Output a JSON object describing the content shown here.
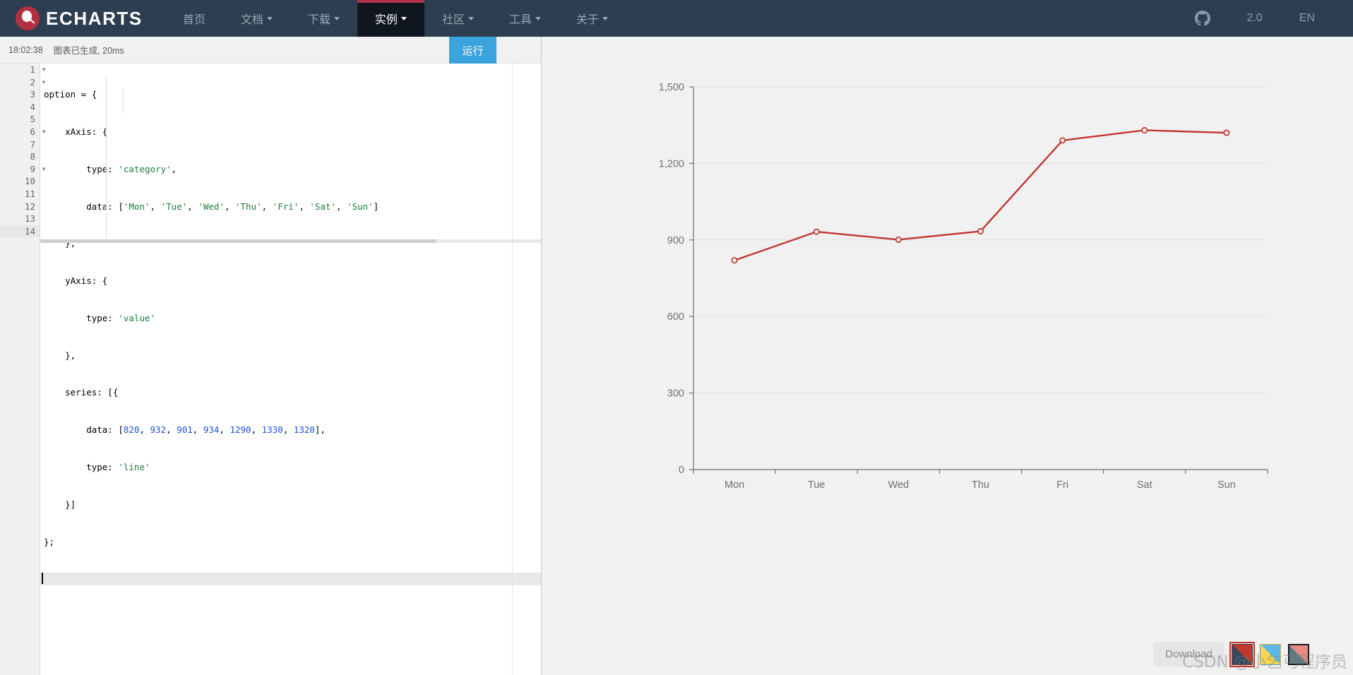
{
  "navbar": {
    "brand": "ECHARTS",
    "brand_icon": "echarts-logo-icon",
    "items": [
      {
        "label": "首页",
        "caret": false,
        "active": false
      },
      {
        "label": "文档",
        "caret": true,
        "active": false
      },
      {
        "label": "下载",
        "caret": true,
        "active": false
      },
      {
        "label": "实例",
        "caret": true,
        "active": true
      },
      {
        "label": "社区",
        "caret": true,
        "active": false
      },
      {
        "label": "工具",
        "caret": true,
        "active": false
      },
      {
        "label": "关于",
        "caret": true,
        "active": false
      }
    ],
    "github_icon": "github-icon",
    "version": "2.0",
    "language": "EN",
    "bg_color": "#2c3e50",
    "active_bg_color": "#101620",
    "active_border_color": "#b33048"
  },
  "editor": {
    "status_time": "18:02:38",
    "status_message": "图表已生成, 20ms",
    "run_label": "运行",
    "run_color": "#3ba3dd",
    "line_numbers": [
      "1",
      "2",
      "3",
      "4",
      "5",
      "6",
      "7",
      "8",
      "9",
      "10",
      "11",
      "12",
      "13",
      "14"
    ],
    "fold_lines": [
      1,
      2,
      6,
      9
    ],
    "active_line": 14,
    "code_lines": [
      "option = {",
      "    xAxis: {",
      "        type: 'category',",
      "        data: ['Mon', 'Tue', 'Wed', 'Thu', 'Fri', 'Sat', 'Sun']",
      "    },",
      "    yAxis: {",
      "        type: 'value'",
      "    },",
      "    series: [{",
      "        data: [820, 932, 901, 934, 1290, 1330, 1320],",
      "        type: 'line'",
      "    }]",
      "};",
      ""
    ]
  },
  "chart_footer": {
    "download_label": "Download",
    "themes": [
      {
        "name": "theme-swatch-default",
        "selected": true
      },
      {
        "name": "theme-swatch-light",
        "selected": false
      },
      {
        "name": "theme-swatch-dark",
        "selected": false
      }
    ]
  },
  "watermark": "CSDN @小乞丐程序员",
  "chart_data": {
    "type": "line",
    "title": "",
    "xlabel": "",
    "ylabel": "",
    "categories": [
      "Mon",
      "Tue",
      "Wed",
      "Thu",
      "Fri",
      "Sat",
      "Sun"
    ],
    "values": [
      820,
      932,
      901,
      934,
      1290,
      1330,
      1320
    ],
    "series": [
      {
        "name": "",
        "values": [
          820,
          932,
          901,
          934,
          1290,
          1330,
          1320
        ]
      }
    ],
    "ylim": [
      0,
      1500
    ],
    "yticks": [
      0,
      300,
      600,
      900,
      1200,
      1500
    ],
    "ytick_labels": [
      "0",
      "300",
      "600",
      "900",
      "1,200",
      "1,500"
    ],
    "grid": true,
    "legend": false,
    "line_color": "#c23531",
    "symbol": "hollow-circle",
    "background_color": "#f1f1f1"
  }
}
